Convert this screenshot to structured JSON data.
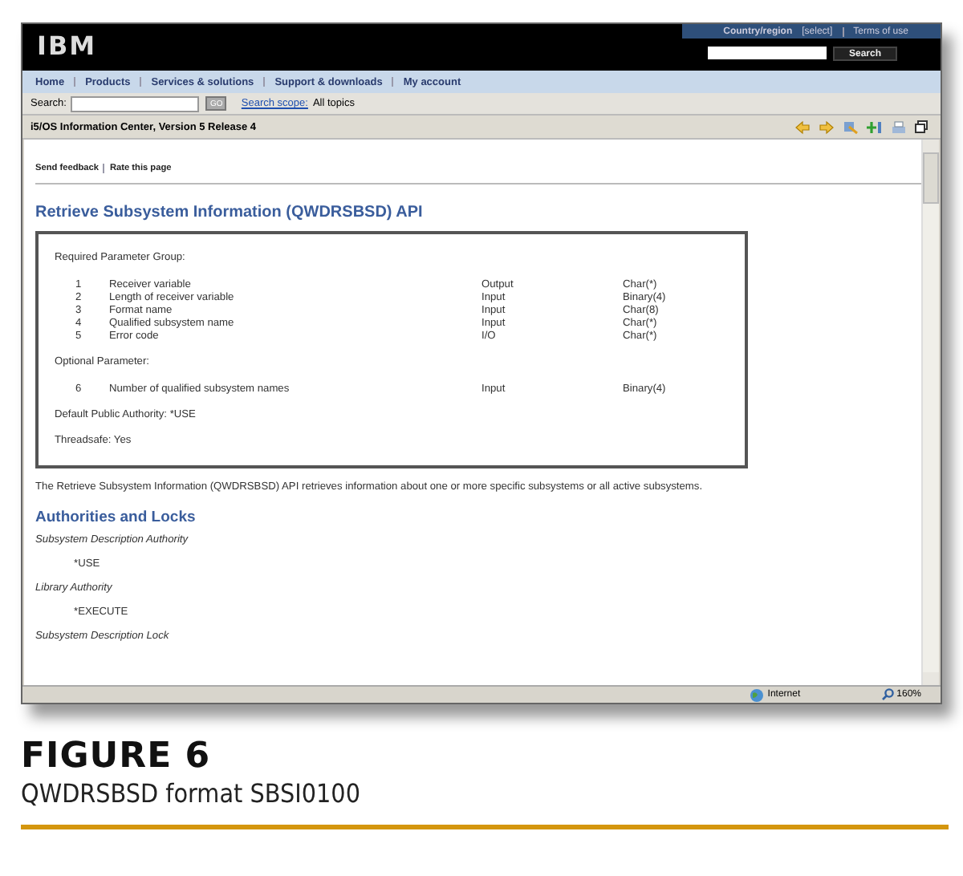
{
  "masthead": {
    "logo": "IBM",
    "links": [
      {
        "text": "Country/region",
        "kind": "bold"
      },
      {
        "text": "[select]",
        "kind": "plain"
      },
      {
        "text": "Terms of use",
        "kind": "plain"
      }
    ],
    "search_button": "Search"
  },
  "nav": [
    "Home",
    "Products",
    "Services & solutions",
    "Support & downloads",
    "My account"
  ],
  "search_bar": {
    "label": "Search:",
    "go": "GO",
    "scope_link": "Search scope:",
    "scope": "All topics"
  },
  "title_bar": {
    "title": "i5/OS Information Center, Version 5 Release 4"
  },
  "feedback_links": [
    "Send feedback",
    "Rate this page"
  ],
  "heading": "Retrieve Subsystem Information (QWDRSBSD) API",
  "parameter_box": {
    "required_label": "Required Parameter Group:",
    "required": [
      {
        "number": "1",
        "name": "Receiver variable",
        "usage": "Output",
        "type": "Char(*)"
      },
      {
        "number": "2",
        "name": "Length of receiver variable",
        "usage": "Input",
        "type": "Binary(4)"
      },
      {
        "number": "3",
        "name": "Format name",
        "usage": "Input",
        "type": "Char(8)"
      },
      {
        "number": "4",
        "name": "Qualified subsystem name",
        "usage": "Input",
        "type": "Char(*)"
      },
      {
        "number": "5",
        "name": "Error code",
        "usage": "I/O",
        "type": "Char(*)"
      }
    ],
    "optional_label": "Optional Parameter:",
    "optional": [
      {
        "number": "6",
        "name": "Number of qualified subsystem names",
        "usage": "Input",
        "type": "Binary(4)"
      }
    ],
    "authority": "Default Public Authority: *USE",
    "threadsafe": "Threadsafe: Yes"
  },
  "description": "The Retrieve Subsystem Information (QWDRSBSD) API retrieves information about one or more specific subsystems or all active subsystems.",
  "section_heading": "Authorities and Locks",
  "authorities": [
    {
      "kind": "label",
      "text": "Subsystem Description Authority"
    },
    {
      "kind": "value",
      "text": "*USE"
    },
    {
      "kind": "label",
      "text": "Library Authority"
    },
    {
      "kind": "value",
      "text": "*EXECUTE"
    },
    {
      "kind": "label",
      "text": "Subsystem Description Lock"
    }
  ],
  "status_bar": {
    "zone": "Internet",
    "zoom": "160%"
  },
  "caption": {
    "figure": "FIGURE 6",
    "text": "QWDRSBSD format SBSI0100"
  }
}
